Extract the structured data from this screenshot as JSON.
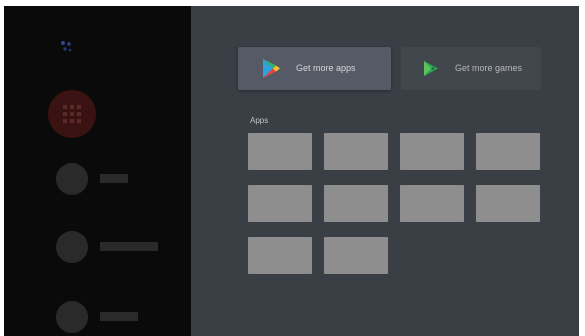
{
  "sidebar": {
    "search": {
      "icon": "google-mic-icon",
      "label": ""
    },
    "apps_item": {
      "icon": "apps-grid-icon",
      "label": "",
      "accent_color": "#3b1212"
    }
  },
  "store_buttons": [
    {
      "label": "Get more apps",
      "icon": "google-play-store-icon"
    },
    {
      "label": "Get more games",
      "icon": "google-play-games-icon"
    }
  ],
  "apps_section": {
    "label": "Apps",
    "tile_count": 10
  },
  "colors": {
    "background": "#3a3e45",
    "sidebar": "#0a0a0a",
    "tile": "#8e8e8e",
    "focused_button": "#565a66"
  }
}
